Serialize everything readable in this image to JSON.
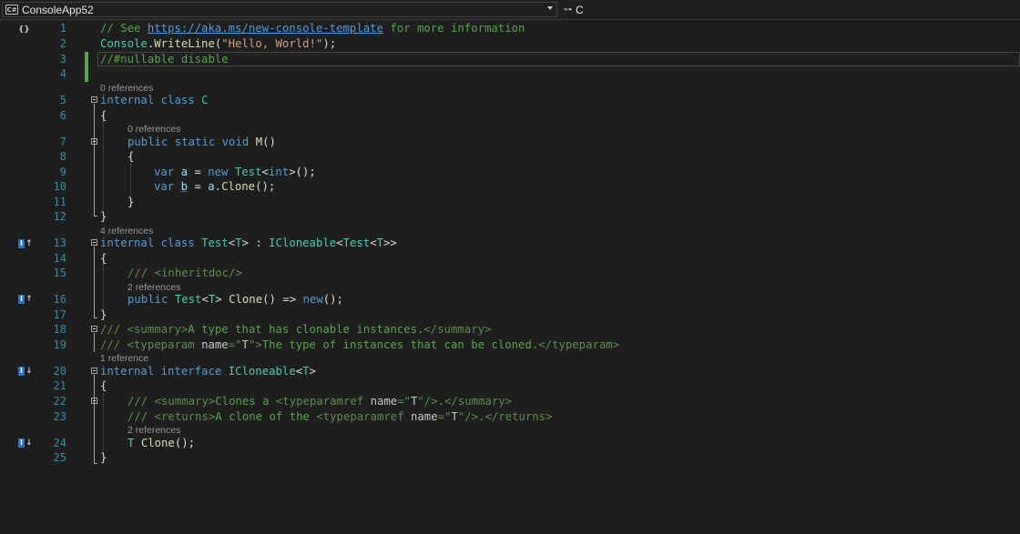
{
  "navbar": {
    "project_icon": "csharp-project-icon",
    "project": "ConsoleApp52",
    "class_icon": "class-member-icon",
    "member": "C"
  },
  "codelens": {
    "class_c": "0 references",
    "method_m": "0 references",
    "class_test": "4 references",
    "method_clone": "2 references",
    "interface": "1 reference",
    "interface_clone": "2 references"
  },
  "line_numbers": [
    "1",
    "2",
    "3",
    "4",
    "5",
    "6",
    "7",
    "8",
    "9",
    "10",
    "11",
    "12",
    "13",
    "14",
    "15",
    "16",
    "17",
    "18",
    "19",
    "20",
    "21",
    "22",
    "23",
    "24",
    "25"
  ],
  "code": {
    "l1": [
      "// See ",
      "https://aka.ms/new-console-template",
      " for more information"
    ],
    "l2": [
      "Console",
      ".",
      "WriteLine",
      "(",
      "\"Hello, World!\"",
      ");"
    ],
    "l3": [
      "//#nullable disable"
    ],
    "l5": [
      "internal",
      " ",
      "class",
      " ",
      "C"
    ],
    "l6": [
      "{"
    ],
    "l7": [
      "public",
      " ",
      "static",
      " ",
      "void",
      " ",
      "M",
      "()"
    ],
    "l8": [
      "{"
    ],
    "l9": [
      "var",
      " ",
      "a",
      " = ",
      "new",
      " ",
      "Test",
      "<",
      "int",
      ">();"
    ],
    "l10": [
      "var",
      " ",
      "b",
      " = ",
      "a",
      ".",
      "Clone",
      "();"
    ],
    "l11": [
      "}"
    ],
    "l12": [
      "}"
    ],
    "l13": [
      "internal",
      " ",
      "class",
      " ",
      "Test",
      "<",
      "T",
      "> : ",
      "ICloneable",
      "<",
      "Test",
      "<",
      "T",
      ">>"
    ],
    "l14": [
      "{"
    ],
    "l15": [
      "/// ",
      "<inheritdoc/>"
    ],
    "l16": [
      "public",
      " ",
      "Test",
      "<",
      "T",
      "> ",
      "Clone",
      "() => ",
      "new",
      "();"
    ],
    "l17": [
      "}"
    ],
    "l18": [
      "/// ",
      "<summary>",
      "A type that has clonable instances.",
      "</summary>"
    ],
    "l19": [
      "/// ",
      "<typeparam ",
      "name",
      "=\"",
      "T",
      "\">",
      "The type of instances that can be cloned.",
      "</typeparam>"
    ],
    "l20": [
      "internal",
      " ",
      "interface",
      " ",
      "ICloneable",
      "<",
      "T",
      ">"
    ],
    "l21": [
      "{"
    ],
    "l22": [
      "/// ",
      "<summary>",
      "Clones a ",
      "<typeparamref ",
      "name",
      "=\"",
      "T",
      "\"/>",
      ".",
      "</summary>"
    ],
    "l23": [
      "/// ",
      "<returns>",
      "A clone of the ",
      "<typeparamref ",
      "name",
      "=\"",
      "T",
      "\"/>",
      ".",
      "</returns>"
    ],
    "l24": [
      "T",
      " ",
      "Clone",
      "();"
    ],
    "l25": [
      "}"
    ]
  },
  "glyphs": {
    "top": "{}",
    "impl_icon": "I",
    "up_arrow": "↑",
    "down_arrow": "↓"
  }
}
